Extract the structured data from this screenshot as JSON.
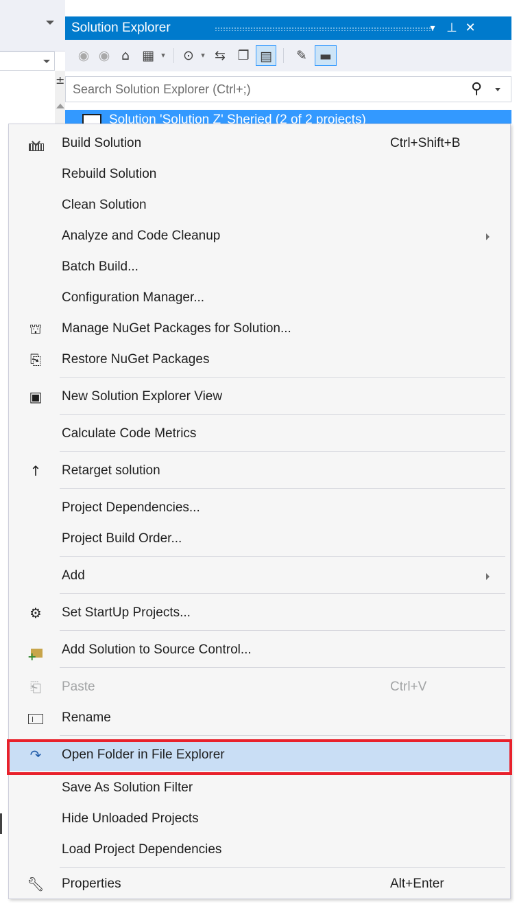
{
  "solution_explorer": {
    "title": "Solution Explorer",
    "title_dropdown": "▾",
    "title_pin": "⊥",
    "title_close": "✕",
    "search_placeholder": "Search Solution Explorer (Ctrl+;)",
    "tree_selected_text": "Solution 'Solution Z' Sheried (2 of 2 projects)"
  },
  "toolbar_icons": [
    "back-icon",
    "forward-icon",
    "home-icon",
    "switch-views-icon",
    "pending-changes-filter-icon",
    "sync-active-document-icon",
    "collapse-all-icon",
    "show-all-files-icon",
    "properties-icon",
    "preview-selected-items-icon"
  ],
  "context_menu": {
    "items": [
      {
        "label": "Build Solution",
        "shortcut": "Ctrl+Shift+B",
        "icon": "build-icon"
      },
      {
        "label": "Rebuild Solution"
      },
      {
        "label": "Clean Solution"
      },
      {
        "label": "Analyze and Code Cleanup",
        "submenu": true
      },
      {
        "label": "Batch Build..."
      },
      {
        "label": "Configuration Manager..."
      },
      {
        "label": "Manage NuGet Packages for Solution...",
        "icon": "nuget-icon"
      },
      {
        "label": "Restore NuGet Packages",
        "icon": "restore-icon"
      },
      {
        "label": "New Solution Explorer View",
        "icon": "new-view-icon"
      },
      {
        "label": "Calculate Code Metrics"
      },
      {
        "label": "Retarget solution",
        "icon": "up-arrow-icon"
      },
      {
        "label": "Project Dependencies..."
      },
      {
        "label": "Project Build Order..."
      },
      {
        "label": "Add",
        "submenu": true
      },
      {
        "label": "Set StartUp Projects...",
        "icon": "gear-icon"
      },
      {
        "label": "Add Solution to Source Control...",
        "icon": "source-control-icon"
      },
      {
        "label": "Paste",
        "shortcut": "Ctrl+V",
        "icon": "paste-icon",
        "disabled": true
      },
      {
        "label": "Rename",
        "icon": "rename-icon"
      },
      {
        "label": "Open Folder in File Explorer",
        "icon": "open-folder-arrow-icon",
        "highlighted": true
      },
      {
        "label": "Save As Solution Filter"
      },
      {
        "label": "Hide Unloaded Projects"
      },
      {
        "label": "Load Project Dependencies"
      },
      {
        "label": "Properties",
        "shortcut": "Alt+Enter",
        "icon": "wrench-icon"
      }
    ]
  },
  "colors": {
    "title_bar": "#007acc",
    "menu_background": "#f6f6f6",
    "hover_background": "#c9def5",
    "highlight_border": "#e8212b",
    "disabled_text": "#a2a4a5"
  }
}
